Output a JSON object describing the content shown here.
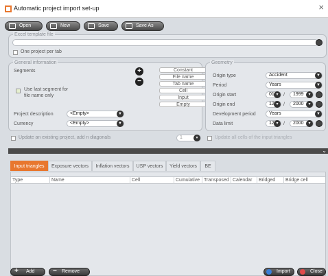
{
  "window": {
    "title": "Automatic project import set-up",
    "close": "×"
  },
  "toolbar": {
    "open": "Open",
    "new": "New",
    "save": "Save",
    "save_as": "Save As"
  },
  "excel": {
    "legend": "Excel template file",
    "path": "",
    "one_per_tab": "One project per tab"
  },
  "general": {
    "legend": "General information",
    "segments_label": "Segments",
    "options": [
      "Constant",
      "File name",
      "Tab name",
      "Cell",
      "Input",
      "Empty"
    ],
    "use_last_segment": "Use last segment for file name only",
    "project_description_label": "Project description",
    "project_description_value": "<Empty>",
    "currency_label": "Currency",
    "currency_value": "<Empty>"
  },
  "geometry": {
    "legend": "Geometry",
    "origin_type_label": "Origin type",
    "origin_type_value": "Accident",
    "period_label": "Period",
    "period_value": "Years",
    "origin_start_label": "Origin start",
    "origin_start_month": "01",
    "origin_start_year": "1999",
    "origin_end_label": "Origin end",
    "origin_end_month": "12",
    "origin_end_year": "2000",
    "dev_period_label": "Development period",
    "dev_period_value": "Years",
    "data_limit_label": "Data limit",
    "data_limit_month": "12",
    "data_limit_year": "2000",
    "sep": "/"
  },
  "update": {
    "label": "Update an existing project, add n diagonals",
    "n_value": "1",
    "all_cells": "Update all cells of the input triangles"
  },
  "tabs": [
    "Input triangles",
    "Exposure vectors",
    "Inflation vectors",
    "USP vectors",
    "Yield vectors",
    "BE"
  ],
  "table": {
    "columns": [
      "Type",
      "Name",
      "Cell",
      "Cumulative",
      "Transposed",
      "Calendar",
      "Bridged",
      "Bridge cell"
    ]
  },
  "footer": {
    "add": "Add",
    "remove": "Remove",
    "import": "Import",
    "close": "Close"
  },
  "colors": {
    "accent": "#e8772e",
    "dark": "#4a4a4a"
  }
}
